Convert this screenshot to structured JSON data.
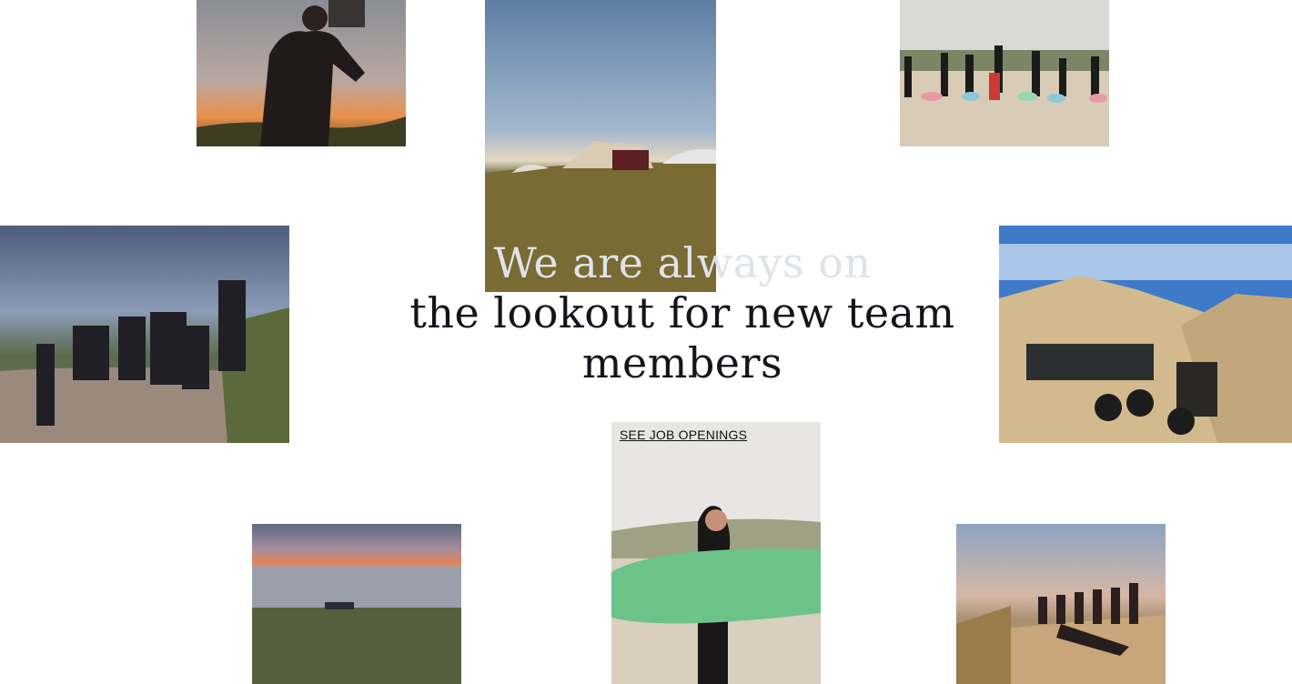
{
  "hero": {
    "headline_line1": "We are always on",
    "headline_line2": "the lookout for new team",
    "headline_line3": "members",
    "cta_label": "SEE JOB OPENINGS"
  },
  "photos": [
    {
      "name": "photo-camera",
      "subject": "person filming with camera at sunset"
    },
    {
      "name": "photo-tents",
      "subject": "camp tents in grassy dunes"
    },
    {
      "name": "photo-surf-group",
      "subject": "surf lesson group on beach"
    },
    {
      "name": "photo-team-dunes",
      "subject": "team posing in dunes at dusk"
    },
    {
      "name": "photo-tent-front",
      "subject": "people sitting in front of tent"
    },
    {
      "name": "photo-surfer",
      "subject": "surfer carrying green board"
    },
    {
      "name": "photo-sunset",
      "subject": "sunset over dunes with group"
    },
    {
      "name": "photo-team-sunset",
      "subject": "team on dune at golden hour"
    }
  ],
  "colors": {
    "background": "#ffffff",
    "headline": "#14141c",
    "cta": "#111111"
  }
}
